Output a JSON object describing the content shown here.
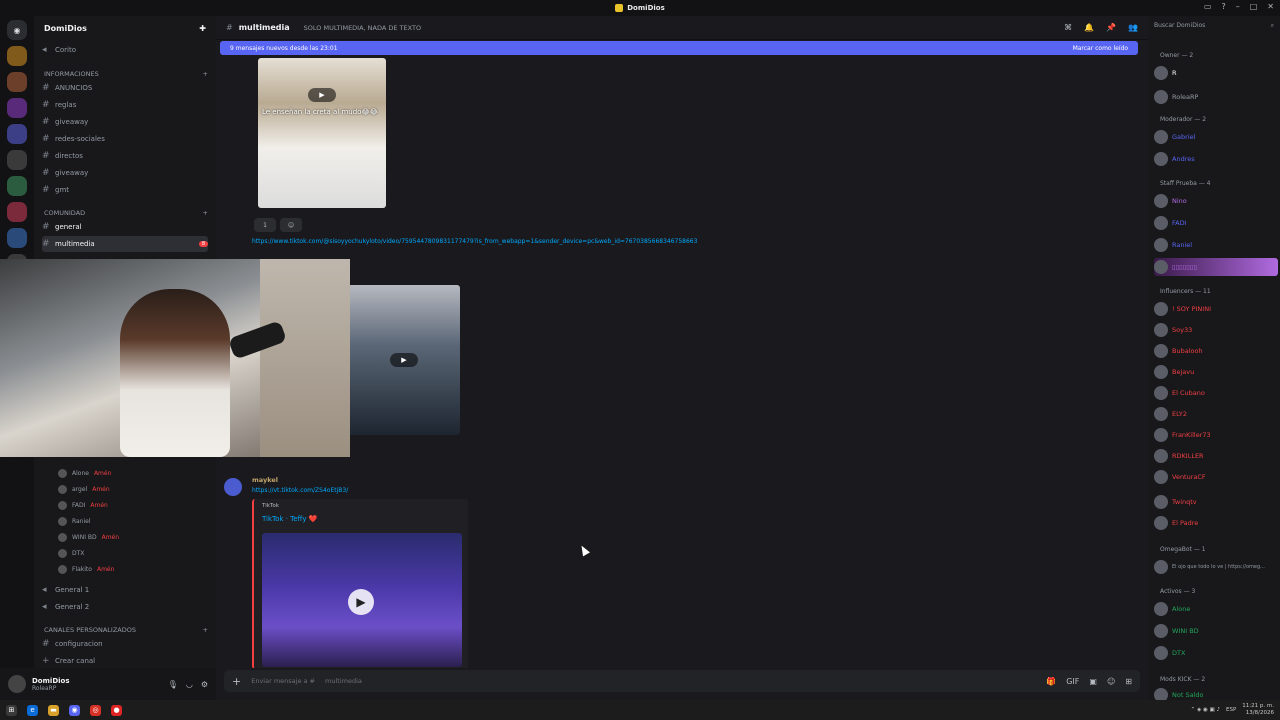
{
  "window": {
    "title": "DomiDios"
  },
  "guild": {
    "name": "DomiDios"
  },
  "channels": {
    "top_item": "Corito",
    "category_info": "INFORMACIONES",
    "info_channels": [
      "ANUNCIOS",
      "reglas",
      "giveaway",
      "redes-sociales",
      "directos",
      "giveaway",
      "gmt"
    ],
    "category_community": "COMUNIDAD",
    "community_channels": [
      "general",
      "multimedia"
    ],
    "voice_users": [
      "Alone",
      "argel",
      "FADI",
      "Raniel",
      "WINI BD",
      "DTX",
      "Flakito"
    ],
    "voice_tag": "Amén",
    "voice_channels": [
      "General 1",
      "General 2"
    ],
    "category_custom": "CANALES PERSONALIZADOS",
    "custom_channels": [
      "configuracion",
      "Crear canal"
    ],
    "unread_count": "8"
  },
  "user": {
    "name": "DomiDios",
    "status": "RoleaRP"
  },
  "header": {
    "channel": "multimedia",
    "topic": "SOLO MULTIMEDIA, NADA DE TEXTO"
  },
  "new_messages": {
    "text": "9 mensajes nuevos desde las 23:01",
    "action": "Marcar como leído"
  },
  "chat": {
    "video1_caption": "Le enseñan la creta al mudo😂😂",
    "reaction_count": "1",
    "link1": "https://www.tiktok.com/@sisoyyochukyloto/video/7595447809831177479?is_from_webapp=1&sender_device=pc&web_id=7670385668346758663",
    "message_author": "maykel",
    "link2": "https://vt.tiktok.com/ZS4oEtjB3/",
    "embed_provider": "TikTok",
    "embed_title": "TikTok · Teffy ❤️"
  },
  "composer": {
    "placeholder": "Enviar mensaje a #",
    "channel": "multimedia"
  },
  "members": {
    "search": "Buscar DomiDios",
    "groups": [
      {
        "name": "Owner — 2",
        "members": [
          {
            "name": "R",
            "color": "#ffffff"
          },
          {
            "name": "RoleaRP",
            "color": "#949ba4"
          }
        ]
      },
      {
        "name": "Moderador — 2",
        "members": [
          {
            "name": "Gabriel",
            "color": "#5865f2"
          },
          {
            "name": "Andres",
            "color": "#5865f2"
          }
        ]
      },
      {
        "name": "Staff Prueba — 4",
        "members": [
          {
            "name": "Nino",
            "color": "#b06be0"
          },
          {
            "name": "FADI",
            "color": "#5865f2"
          },
          {
            "name": "Raniel",
            "color": "#5865f2"
          },
          {
            "name": "▯▯▯▯▯▯▯",
            "color": "#b06be0"
          }
        ]
      },
      {
        "name": "Influencers — 11",
        "members": [
          {
            "name": "! SOY PININI",
            "color": "#f23f42"
          },
          {
            "name": "Soy33",
            "color": "#f23f42"
          },
          {
            "name": "Bubalooh",
            "color": "#f23f42"
          },
          {
            "name": "Bejavu",
            "color": "#f23f42"
          },
          {
            "name": "El Cubano",
            "color": "#f23f42"
          },
          {
            "name": "ELY2",
            "color": "#f23f42"
          },
          {
            "name": "FranKiller73",
            "color": "#f23f42"
          },
          {
            "name": "RDKILLER",
            "color": "#f23f42"
          },
          {
            "name": "VenturaCF",
            "color": "#f23f42"
          },
          {
            "name": "Twinqtv",
            "color": "#f23f42"
          },
          {
            "name": "El Padre",
            "color": "#f23f42"
          }
        ]
      },
      {
        "name": "OmegaBot — 1",
        "members": [
          {
            "name": "El ojo que todo lo ve | https://omeg...",
            "color": "#949ba4"
          }
        ]
      },
      {
        "name": "Activos — 3",
        "members": [
          {
            "name": "Alone",
            "color": "#23a55a"
          },
          {
            "name": "WINI BD",
            "color": "#23a55a"
          },
          {
            "name": "DTX",
            "color": "#23a55a"
          }
        ]
      },
      {
        "name": "Mods KICK — 2",
        "members": [
          {
            "name": "Not Saldo",
            "color": "#23a55a"
          }
        ]
      }
    ]
  },
  "taskbar": {
    "time": "11:21 p. m.",
    "date": "13/8/2026",
    "lang": "ESP"
  }
}
